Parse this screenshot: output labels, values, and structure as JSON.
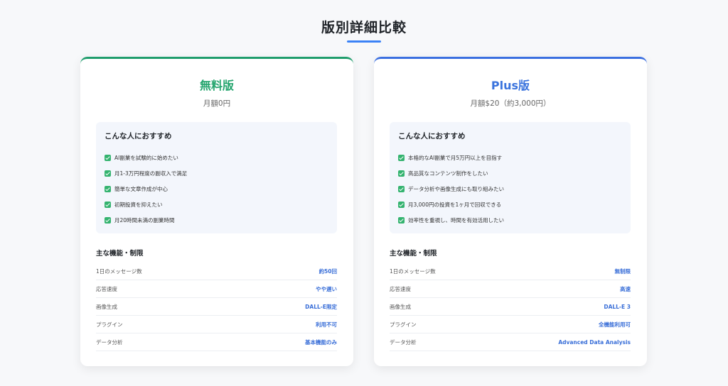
{
  "page": {
    "title": "版別詳細比較"
  },
  "plans": [
    {
      "name": "無料版",
      "price": "月額0円",
      "recommend_heading": "こんな人におすすめ",
      "recommend": [
        "AI副業を試験的に始めたい",
        "月1-3万円程度の副収入で満足",
        "簡単な文章作成が中心",
        "初期投資を抑えたい",
        "月20時間未満の副業時間"
      ],
      "features_heading": "主な機能・制限",
      "features": [
        {
          "label": "1日のメッセージ数",
          "value": "約50回"
        },
        {
          "label": "応答速度",
          "value": "やや遅い"
        },
        {
          "label": "画像生成",
          "value": "DALL-E限定"
        },
        {
          "label": "プラグイン",
          "value": "利用不可"
        },
        {
          "label": "データ分析",
          "value": "基本機能のみ"
        }
      ]
    },
    {
      "name": "Plus版",
      "price": "月額$20（約3,000円）",
      "recommend_heading": "こんな人におすすめ",
      "recommend": [
        "本格的なAI副業で月5万円以上を目指す",
        "高品質なコンテンツ制作をしたい",
        "データ分析や画像生成にも取り組みたい",
        "月3,000円の投資を1ヶ月で回収できる",
        "効率性を重視し、時間を有効活用したい"
      ],
      "features_heading": "主な機能・制限",
      "features": [
        {
          "label": "1日のメッセージ数",
          "value": "無制限"
        },
        {
          "label": "応答速度",
          "value": "高速"
        },
        {
          "label": "画像生成",
          "value": "DALL-E 3"
        },
        {
          "label": "プラグイン",
          "value": "全機能利用可"
        },
        {
          "label": "データ分析",
          "value": "Advanced Data Analysis"
        }
      ]
    }
  ],
  "colors": {
    "free_accent": "#25a56e",
    "plus_accent": "#3a73dd",
    "check": "#34b36f",
    "value_text": "#3a6fd8"
  },
  "icons": {
    "check": "check-icon"
  }
}
